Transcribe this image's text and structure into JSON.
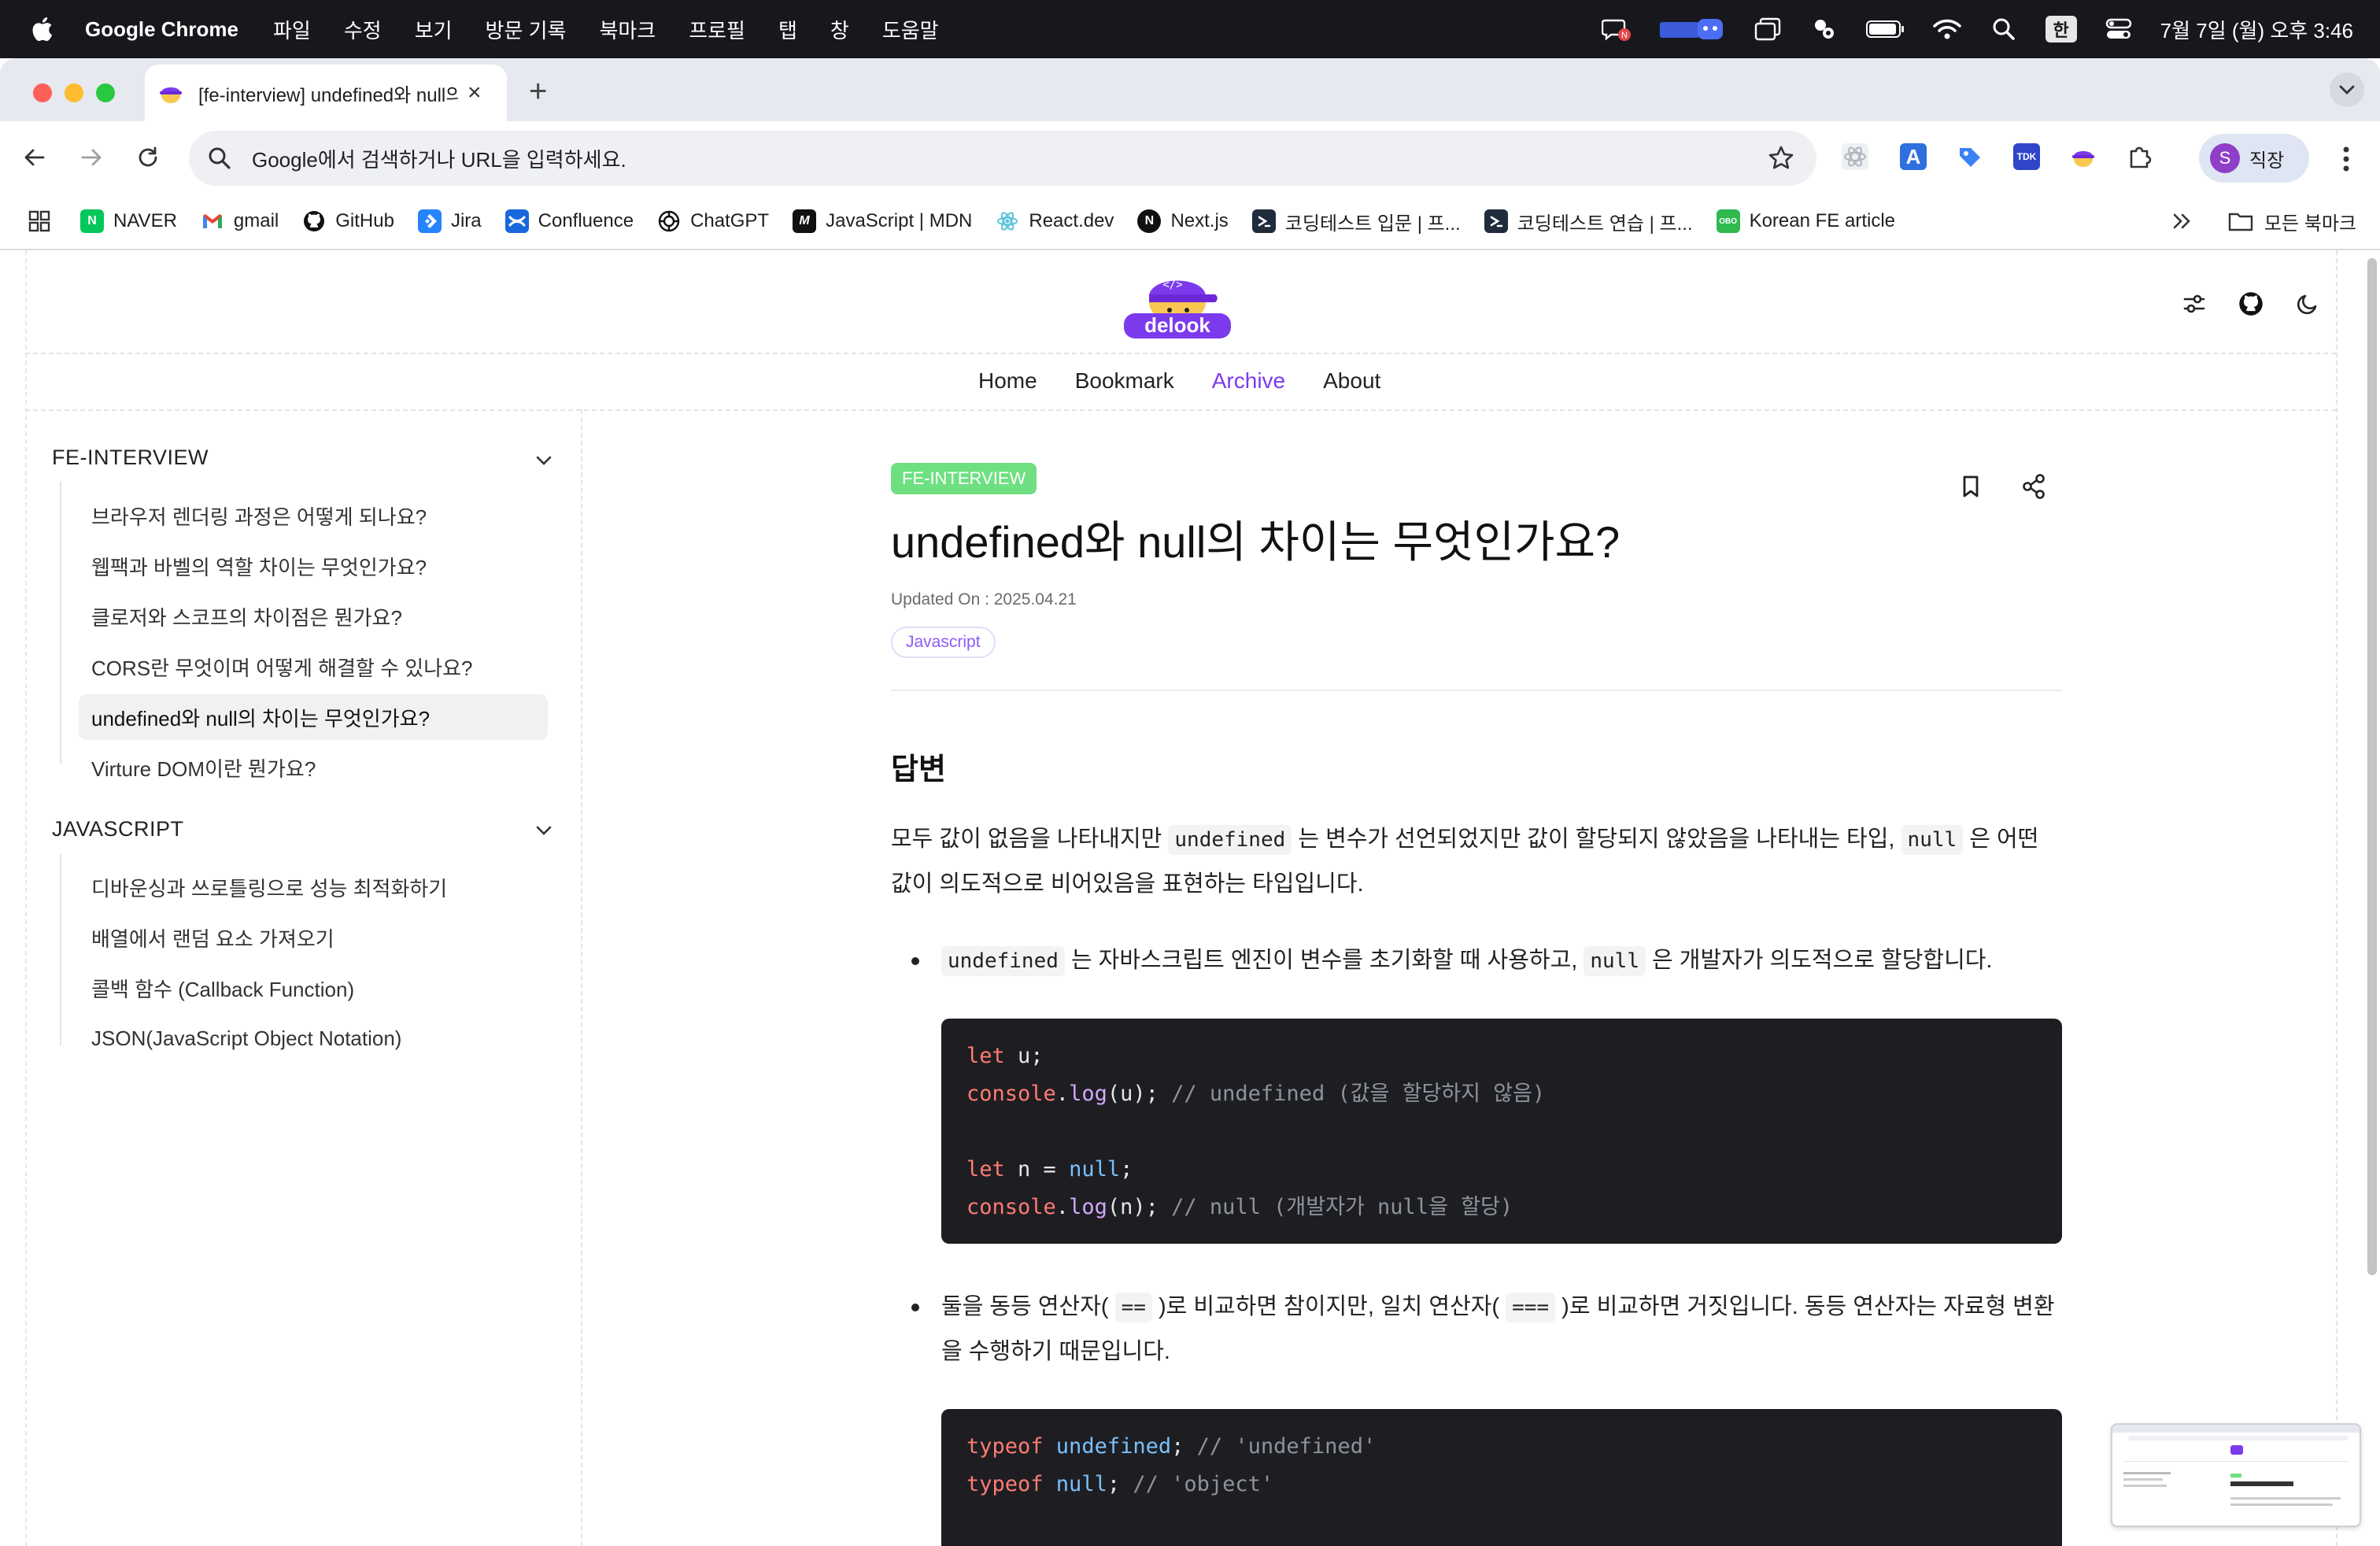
{
  "menubar": {
    "app_name": "Google Chrome",
    "items": [
      "파일",
      "수정",
      "보기",
      "방문 기록",
      "북마크",
      "프로필",
      "탭",
      "창",
      "도움말"
    ],
    "input_method": "한",
    "clock": "7월 7일 (월) 오후 3:46"
  },
  "tab": {
    "title": "[fe-interview] undefined와 null의 차이는 무엇인가요?"
  },
  "omnibox": {
    "placeholder": "Google에서 검색하거나 URL을 입력하세요."
  },
  "profile": {
    "initial": "S",
    "name": "직장"
  },
  "bookmarks": {
    "items": [
      {
        "label": "NAVER",
        "icon": "naver-icon",
        "color": "#03c75a",
        "glyph": "N"
      },
      {
        "label": "gmail",
        "icon": "gmail-icon",
        "color": "#ea4335",
        "glyph": "M"
      },
      {
        "label": "GitHub",
        "icon": "github-icon",
        "color": "#111111",
        "glyph": ""
      },
      {
        "label": "Jira",
        "icon": "jira-icon",
        "color": "#2684ff",
        "glyph": ""
      },
      {
        "label": "Confluence",
        "icon": "confluence-icon",
        "color": "#1868db",
        "glyph": ""
      },
      {
        "label": "ChatGPT",
        "icon": "chatgpt-icon",
        "color": "#111111",
        "glyph": ""
      },
      {
        "label": "JavaScript | MDN",
        "icon": "mdn-icon",
        "color": "#111111",
        "glyph": "M"
      },
      {
        "label": "React.dev",
        "icon": "react-icon",
        "color": "#58c4dc",
        "glyph": ""
      },
      {
        "label": "Next.js",
        "icon": "nextjs-icon",
        "color": "#111111",
        "glyph": "N"
      },
      {
        "label": "코딩테스트 입문 | 프...",
        "icon": "programmers-icon",
        "color": "#202b3d",
        "glyph": ""
      },
      {
        "label": "코딩테스트 연습 | 프...",
        "icon": "programmers-icon",
        "color": "#202b3d",
        "glyph": ""
      },
      {
        "label": "Korean FE article",
        "icon": "kofe-icon",
        "color": "#2fb94f",
        "glyph": "OBO"
      }
    ],
    "all_bookmarks": "모든 북마크"
  },
  "site": {
    "logo_text": "delook",
    "nav": [
      {
        "label": "Home",
        "active": false
      },
      {
        "label": "Bookmark",
        "active": false
      },
      {
        "label": "Archive",
        "active": true
      },
      {
        "label": "About",
        "active": false
      }
    ],
    "accent": "#7c3aed"
  },
  "sidebar": {
    "sections": [
      {
        "title": "FE-INTERVIEW",
        "items": [
          {
            "label": "브라우저 렌더링 과정은 어떻게 되나요?",
            "active": false
          },
          {
            "label": "웹팩과 바벨의 역할 차이는 무엇인가요?",
            "active": false
          },
          {
            "label": "클로저와 스코프의 차이점은 뭔가요?",
            "active": false
          },
          {
            "label": "CORS란 무엇이며 어떻게 해결할 수 있나요?",
            "active": false
          },
          {
            "label": "undefined와 null의 차이는 무엇인가요?",
            "active": true
          },
          {
            "label": "Virture DOM이란 뭔가요?",
            "active": false
          }
        ]
      },
      {
        "title": "JAVASCRIPT",
        "items": [
          {
            "label": "디바운싱과 쓰로틀링으로 성능 최적화하기",
            "active": false
          },
          {
            "label": "배열에서 랜덤 요소 가져오기",
            "active": false
          },
          {
            "label": "콜백 함수 (Callback Function)",
            "active": false
          },
          {
            "label": "JSON(JavaScript Object Notation)",
            "active": false
          }
        ]
      }
    ]
  },
  "article": {
    "category": "FE-INTERVIEW",
    "category_color": "#6ee081",
    "title": "undefined와 null의 차이는 무엇인가요?",
    "updated": "Updated On : 2025.04.21",
    "tag": "Javascript",
    "heading": "답변",
    "intro": {
      "t1": "모두 값이 없음을 나타내지만 ",
      "c1": "undefined",
      "t2": " 는 변수가 선언되었지만 값이 할당되지 않았음을 나타내는 타입, ",
      "c2": "null",
      "t3": " 은 어떤 값이 의도적으로 비어있음을 표현하는 타입입니다."
    },
    "bullet1": {
      "c1": "undefined",
      "t1": " 는 자바스크립트 엔진이 변수를 초기화할 때 사용하고, ",
      "c2": "null",
      "t2": " 은 개발자가 의도적으로 할당합니다."
    },
    "code1": {
      "l1_kw": "let",
      "l1_rest": " u;",
      "l2_obj": "console",
      "l2_dot": ".",
      "l2_fn": "log",
      "l2_rest": "(u);",
      "l2_cm": " // undefined (값을 할당하지 않음)",
      "l3_kw": "let",
      "l3_mid": " n = ",
      "l3_lit": "null",
      "l3_end": ";",
      "l4_obj": "console",
      "l4_dot": ".",
      "l4_fn": "log",
      "l4_rest": "(n);",
      "l4_cm": " // null (개발자가 null을 할당)"
    },
    "bullet2": {
      "t1": "둘을 동등 연산자( ",
      "c1": "==",
      "t2": " )로 비교하면 참이지만, 일치 연산자( ",
      "c2": "===",
      "t3": " )로 비교하면 거짓입니다. 동등 연산자는 자료형 변환을 수행하기 때문입니다."
    },
    "code2": {
      "l1_kw": "typeof",
      "l1_lit": " undefined",
      "l1_semi": ";",
      "l1_cm": " // 'undefined'",
      "l2_kw": "typeof",
      "l2_lit": " null",
      "l2_semi": ";",
      "l2_cm": " // 'object'"
    }
  }
}
